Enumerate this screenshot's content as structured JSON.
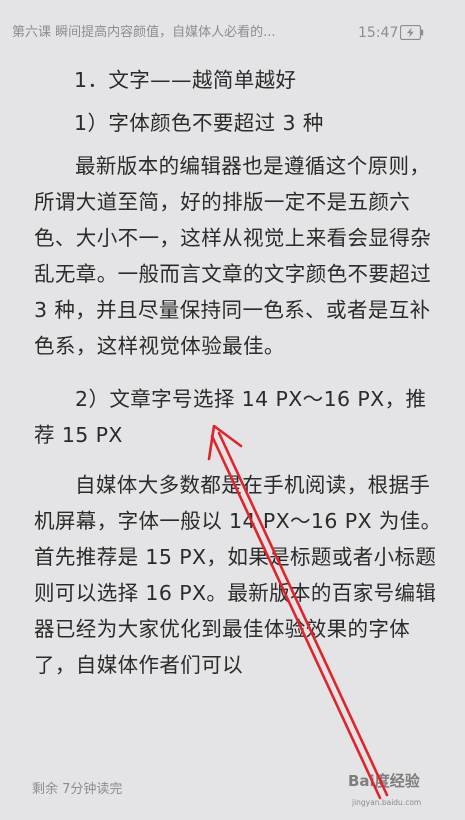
{
  "status_bar": {
    "book_title": "第六课 瞬间提高内容颜值，自媒体人必看的...",
    "time": "15:47"
  },
  "article": {
    "heading_1": "1．文字——越简单越好",
    "subheading_1": "1）字体颜色不要超过 3 种",
    "paragraph_1": "最新版本的编辑器也是遵循这个原则，所谓大道至简，好的排版一定不是五颜六色、大小不一，这样从视觉上来看会显得杂乱无章。一般而言文章的文字颜色不要超过 3 种，并且尽量保持同一色系、或者是互补色系，这样视觉体验最佳。",
    "subheading_2": "2）文章字号选择 14 PX～16 PX，推荐 15 PX",
    "paragraph_2": "自媒体大多数都是在手机阅读，根据手机屏幕，字体一般以 14 PX～16 PX 为佳。首先推荐是 15 PX，如果是标题或者小标题则可以选择 16 PX。最新版本的百家号编辑器已经为大家优化到最佳体验效果的字体了，自媒体作者们可以"
  },
  "footer": {
    "remaining_time": "剩余 7分钟读完"
  },
  "watermark": {
    "brand": "Bai度经验",
    "url": "jingyan.baidu.com"
  },
  "colors": {
    "background": "#e4e4e6",
    "text": "#2b2b2b",
    "meta_text": "#8d8d8d",
    "annotation_arrow": "#e0242b"
  }
}
